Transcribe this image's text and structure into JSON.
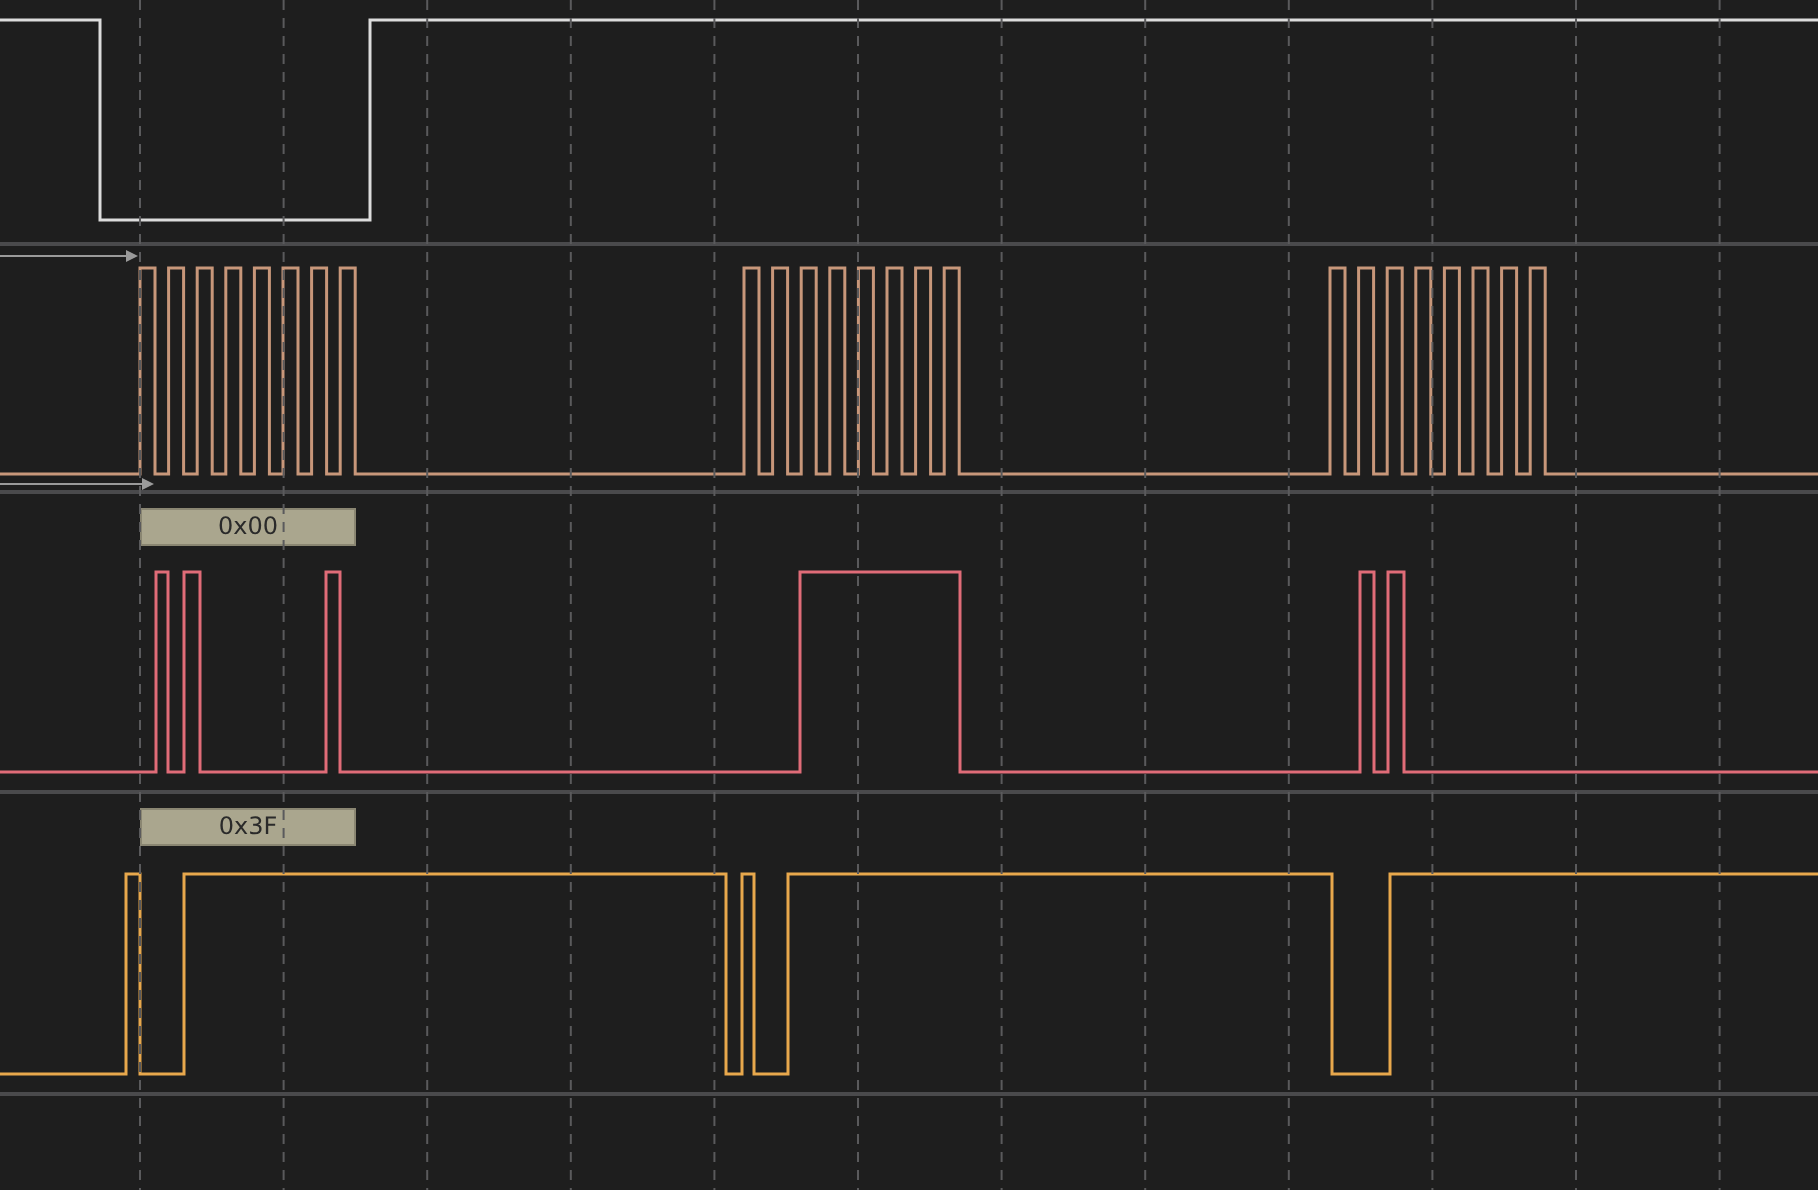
{
  "channels": [
    {
      "color": "#dcdcdc"
    },
    {
      "color": "#c8977a"
    },
    {
      "color": "#e06c78",
      "decode": "0x00"
    },
    {
      "color": "#e8a84c",
      "decode": "0x3F"
    }
  ]
}
